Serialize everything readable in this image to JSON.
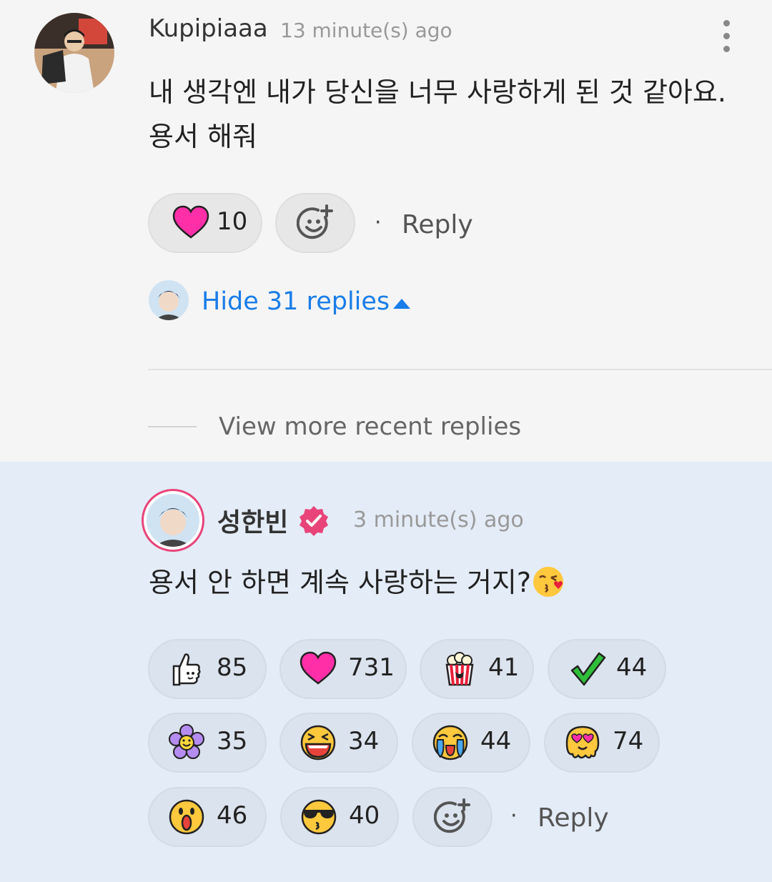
{
  "comment": {
    "username": "Kupipiaaa",
    "time": "13 minute(s) ago",
    "text": "내 생각엔 내가 당신을 너무 사랑하게 된 것 같아요. 용서 해줘",
    "reactions": [
      {
        "icon": "heart-icon",
        "count": "10"
      }
    ],
    "reply_label": "Reply",
    "hide_replies": "Hide 31 replies",
    "view_more": "View more recent replies"
  },
  "reply": {
    "username": "성한빈",
    "verified": true,
    "time": "3 minute(s) ago",
    "text": "용서 안 하면 계속 사랑하는 거지?",
    "text_emoji": "kissing-face-icon",
    "reply_label": "Reply",
    "reactions": [
      {
        "icon": "thumbs-up-icon",
        "count": "85"
      },
      {
        "icon": "heart-icon",
        "count": "731"
      },
      {
        "icon": "popcorn-icon",
        "count": "41"
      },
      {
        "icon": "check-icon",
        "count": "44"
      },
      {
        "icon": "flower-icon",
        "count": "35"
      },
      {
        "icon": "laughing-face-icon",
        "count": "34"
      },
      {
        "icon": "crying-face-icon",
        "count": "44"
      },
      {
        "icon": "heart-eyes-melting-icon",
        "count": "74"
      },
      {
        "icon": "surprised-face-icon",
        "count": "46"
      },
      {
        "icon": "sunglasses-face-icon",
        "count": "40"
      }
    ]
  },
  "colors": {
    "accent_blue": "#1a7de8",
    "heart": "#ff2fa8",
    "verified": "#e8447a"
  }
}
